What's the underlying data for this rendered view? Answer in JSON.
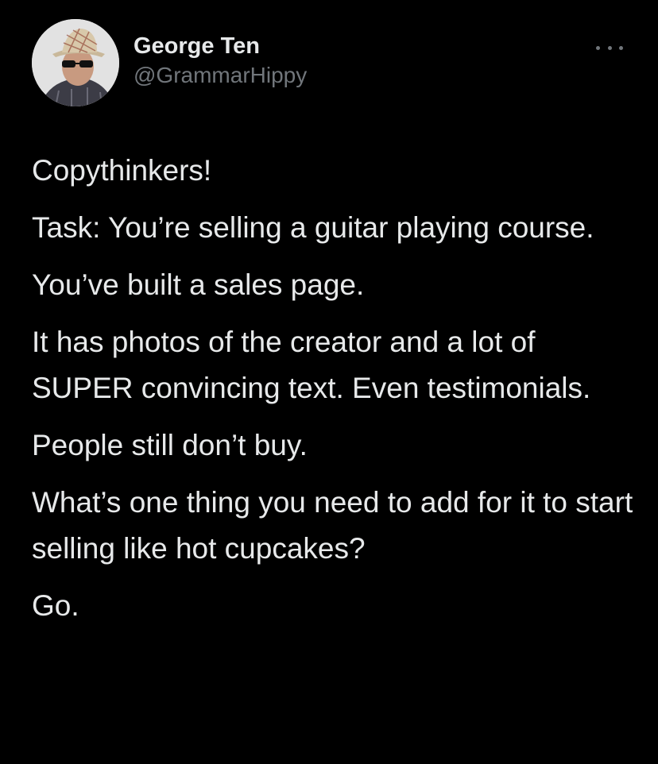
{
  "tweet": {
    "author": {
      "display_name": "George Ten",
      "handle": "@GrammarHippy",
      "avatar_icon": "user-avatar-photo"
    },
    "more_icon": "more-options-icon",
    "paragraphs": [
      "Copythinkers!",
      "Task: You’re selling a guitar playing course.",
      "You’ve built a sales page.",
      "It has photos of the creator and a lot of SUPER convincing text. Even testimonials.",
      "People still don’t buy.",
      "What’s one thing you need to add for it to start selling like hot cupcakes?",
      "Go."
    ]
  },
  "colors": {
    "background": "#000000",
    "primary_text": "#e7e9ea",
    "secondary_text": "#71767b"
  }
}
